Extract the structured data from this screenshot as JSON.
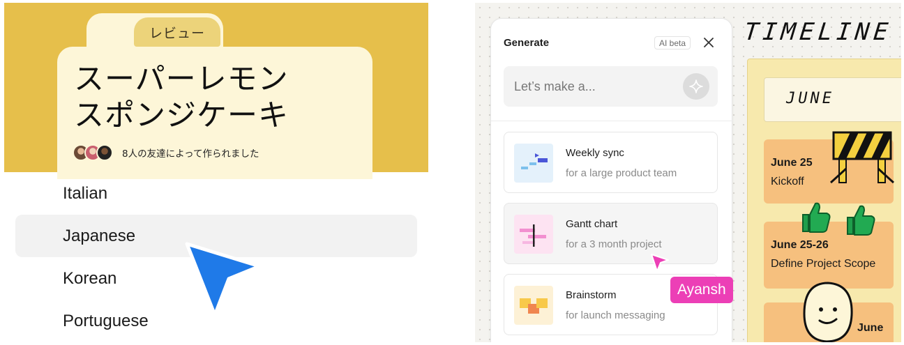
{
  "left_panel": {
    "review_tab_label": "レビュー",
    "recipe_title_line1": "スーパーレモン",
    "recipe_title_line2": "スポンジケーキ",
    "friends_text": "8人の友達によって作られました",
    "header_color": "#e6bf4b",
    "languages": [
      {
        "label": "Italian",
        "selected": false
      },
      {
        "label": "Japanese",
        "selected": true
      },
      {
        "label": "Korean",
        "selected": false
      },
      {
        "label": "Portuguese",
        "selected": false
      }
    ],
    "pointer_color": "#1f7ae8"
  },
  "generate_panel": {
    "title": "Generate",
    "badge": "AI beta",
    "close_icon": "close-icon",
    "prompt_placeholder": "Let’s make a...",
    "sparkle_icon": "sparkle-icon",
    "templates": [
      {
        "name": "Weekly sync",
        "description": "for a large product team",
        "thumb_color": "#e4f1fb"
      },
      {
        "name": "Gantt chart",
        "description": "for a 3 month project",
        "thumb_color": "#fde3f2"
      },
      {
        "name": "Brainstorm",
        "description": "for launch messaging",
        "thumb_color": "#fdf1d6"
      }
    ]
  },
  "collaborator": {
    "name": "Ayansh",
    "color": "#ec3fb6"
  },
  "timeline": {
    "title": "TIMELINE",
    "month": "JUNE",
    "events": [
      {
        "date": "June 25",
        "label": "Kickoff"
      },
      {
        "date": "June 25-26",
        "label": "Define Project Scope"
      },
      {
        "date": "June",
        "label": ""
      }
    ],
    "event_color": "#f6c07e"
  }
}
